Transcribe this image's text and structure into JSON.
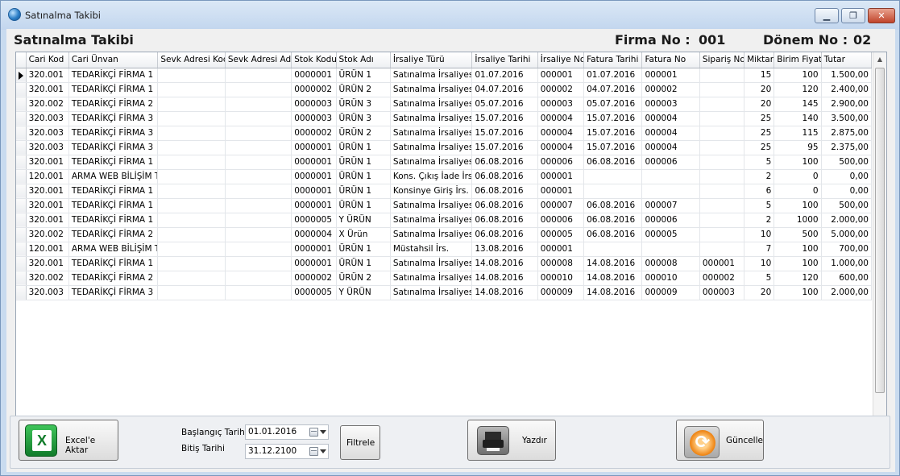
{
  "window": {
    "title": "Satınalma Takibi"
  },
  "header": {
    "title": "Satınalma Takibi",
    "firma_label": "Firma No :",
    "firma_value": "001",
    "donem_label": "Dönem No :",
    "donem_value": "02"
  },
  "grid": {
    "columns": [
      "Cari Kod",
      "Cari Ünvan",
      "Sevk Adresi Kod",
      "Sevk Adresi Adı",
      "Stok Kodu",
      "Stok Adı",
      "İrsaliye Türü",
      "İrsaliye Tarihi",
      "İrsaliye No",
      "Fatura Tarihi",
      "Fatura No",
      "Sipariş No",
      "Miktar",
      "Birim Fiyat",
      "Tutar"
    ],
    "rows": [
      [
        "320.001",
        "TEDARİKÇİ FİRMA 1",
        "",
        "",
        "0000001",
        "ÜRÜN 1",
        "Satınalma İrsaliyesi",
        "01.07.2016",
        "000001",
        "01.07.2016",
        "000001",
        "",
        "15",
        "100",
        "1.500,00"
      ],
      [
        "320.001",
        "TEDARİKÇİ FİRMA 1",
        "",
        "",
        "0000002",
        "ÜRÜN 2",
        "Satınalma İrsaliyesi",
        "04.07.2016",
        "000002",
        "04.07.2016",
        "000002",
        "",
        "20",
        "120",
        "2.400,00"
      ],
      [
        "320.002",
        "TEDARİKÇİ FİRMA 2",
        "",
        "",
        "0000003",
        "ÜRÜN 3",
        "Satınalma İrsaliyesi",
        "05.07.2016",
        "000003",
        "05.07.2016",
        "000003",
        "",
        "20",
        "145",
        "2.900,00"
      ],
      [
        "320.003",
        "TEDARİKÇİ FİRMA 3",
        "",
        "",
        "0000003",
        "ÜRÜN 3",
        "Satınalma İrsaliyesi",
        "15.07.2016",
        "000004",
        "15.07.2016",
        "000004",
        "",
        "25",
        "140",
        "3.500,00"
      ],
      [
        "320.003",
        "TEDARİKÇİ FİRMA 3",
        "",
        "",
        "0000002",
        "ÜRÜN 2",
        "Satınalma İrsaliyesi",
        "15.07.2016",
        "000004",
        "15.07.2016",
        "000004",
        "",
        "25",
        "115",
        "2.875,00"
      ],
      [
        "320.003",
        "TEDARİKÇİ FİRMA 3",
        "",
        "",
        "0000001",
        "ÜRÜN 1",
        "Satınalma İrsaliyesi",
        "15.07.2016",
        "000004",
        "15.07.2016",
        "000004",
        "",
        "25",
        "95",
        "2.375,00"
      ],
      [
        "320.001",
        "TEDARİKÇİ FİRMA 1",
        "",
        "",
        "0000001",
        "ÜRÜN 1",
        "Satınalma İrsaliyesi",
        "06.08.2016",
        "000006",
        "06.08.2016",
        "000006",
        "",
        "5",
        "100",
        "500,00"
      ],
      [
        "120.001",
        "ARMA WEB BİLİŞİM TE",
        "",
        "",
        "0000001",
        "ÜRÜN 1",
        "Kons. Çıkış İade İrs.",
        "06.08.2016",
        "000001",
        "",
        "",
        "",
        "2",
        "0",
        "0,00"
      ],
      [
        "320.001",
        "TEDARİKÇİ FİRMA 1",
        "",
        "",
        "0000001",
        "ÜRÜN 1",
        "Konsinye Giriş İrs.",
        "06.08.2016",
        "000001",
        "",
        "",
        "",
        "6",
        "0",
        "0,00"
      ],
      [
        "320.001",
        "TEDARİKÇİ FİRMA 1",
        "",
        "",
        "0000001",
        "ÜRÜN 1",
        "Satınalma İrsaliyesi",
        "06.08.2016",
        "000007",
        "06.08.2016",
        "000007",
        "",
        "5",
        "100",
        "500,00"
      ],
      [
        "320.001",
        "TEDARİKÇİ FİRMA 1",
        "",
        "",
        "0000005",
        "Y ÜRÜN",
        "Satınalma İrsaliyesi",
        "06.08.2016",
        "000006",
        "06.08.2016",
        "000006",
        "",
        "2",
        "1000",
        "2.000,00"
      ],
      [
        "320.002",
        "TEDARİKÇİ FİRMA 2",
        "",
        "",
        "0000004",
        "X Ürün",
        "Satınalma İrsaliyesi",
        "06.08.2016",
        "000005",
        "06.08.2016",
        "000005",
        "",
        "10",
        "500",
        "5.000,00"
      ],
      [
        "120.001",
        "ARMA WEB BİLİŞİM TE",
        "",
        "",
        "0000001",
        "ÜRÜN 1",
        "Müstahsil İrs.",
        "13.08.2016",
        "000001",
        "",
        "",
        "",
        "7",
        "100",
        "700,00"
      ],
      [
        "320.001",
        "TEDARİKÇİ FİRMA 1",
        "",
        "",
        "0000001",
        "ÜRÜN 1",
        "Satınalma İrsaliyesi",
        "14.08.2016",
        "000008",
        "14.08.2016",
        "000008",
        "000001",
        "10",
        "100",
        "1.000,00"
      ],
      [
        "320.002",
        "TEDARİKÇİ FİRMA 2",
        "",
        "",
        "0000002",
        "ÜRÜN 2",
        "Satınalma İrsaliyesi",
        "14.08.2016",
        "000010",
        "14.08.2016",
        "000010",
        "000002",
        "5",
        "120",
        "600,00"
      ],
      [
        "320.003",
        "TEDARİKÇİ FİRMA 3",
        "",
        "",
        "0000005",
        "Y ÜRÜN",
        "Satınalma İrsaliyesi",
        "14.08.2016",
        "000009",
        "14.08.2016",
        "000009",
        "000003",
        "20",
        "100",
        "2.000,00"
      ]
    ]
  },
  "footer": {
    "excel_label": "Excel'e Aktar",
    "start_date_label": "Başlangıç Tarihi",
    "start_date_value": "01.01.2016",
    "end_date_label": "Bitiş Tarihi",
    "end_date_value": "31.12.2100",
    "filter_label": "Filtrele",
    "print_label": "Yazdır",
    "update_label": "Güncelle"
  }
}
